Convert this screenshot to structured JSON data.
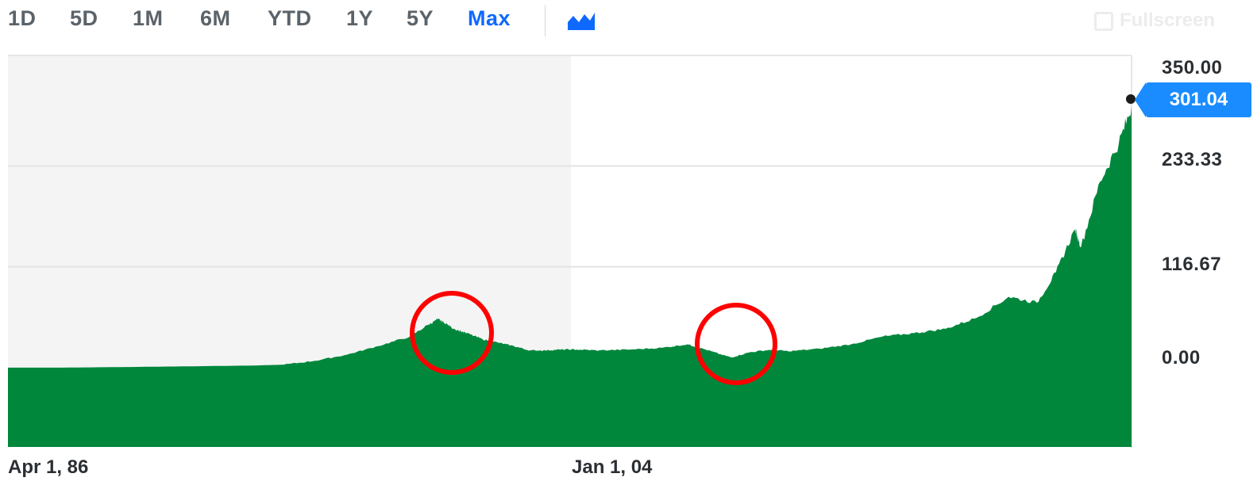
{
  "toolbar": {
    "ranges": [
      "1D",
      "5D",
      "1M",
      "6M",
      "YTD",
      "1Y",
      "5Y",
      "Max"
    ],
    "active_range": "Max",
    "chart_type_icon": "mountain-chart-icon",
    "fullscreen_label": "Fullscreen",
    "accent_color": "#0f69ff"
  },
  "chart_data": {
    "type": "area",
    "title": "",
    "xlabel": "",
    "ylabel": "",
    "x_tick_labels": [
      "Apr 1, 86",
      "Jan 1, 04"
    ],
    "y_tick_labels": [
      "350.00",
      "233.33",
      "116.67",
      "0.00"
    ],
    "ylim": [
      0,
      350
    ],
    "grid": true,
    "last_price": "301.04",
    "area_color": "#00873c",
    "volume_color": "#7ec89a",
    "price_tag_color": "#1a8cff",
    "annotations": [
      {
        "shape": "circle",
        "color": "#ff0000",
        "near": "2000 peak"
      },
      {
        "shape": "circle",
        "color": "#ff0000",
        "near": "2009 trough"
      }
    ],
    "series": [
      {
        "values": [
          [
            1986.25,
            0.1
          ],
          [
            1988,
            0.1
          ],
          [
            1990,
            0.8
          ],
          [
            1992,
            1.6
          ],
          [
            1994,
            2.5
          ],
          [
            1995,
            3.5
          ],
          [
            1996,
            8
          ],
          [
            1997,
            15
          ],
          [
            1998,
            25
          ],
          [
            1999,
            36
          ],
          [
            1999.6,
            50
          ],
          [
            1999.9,
            56
          ],
          [
            2000.1,
            52
          ],
          [
            2000.4,
            45
          ],
          [
            2000.8,
            40
          ],
          [
            2001.3,
            33
          ],
          [
            2001.8,
            29
          ],
          [
            2002.3,
            25
          ],
          [
            2002.8,
            20
          ],
          [
            2003.3,
            20
          ],
          [
            2003.8,
            21
          ],
          [
            2004.3,
            21
          ],
          [
            2005,
            20
          ],
          [
            2006,
            21
          ],
          [
            2007,
            23
          ],
          [
            2007.8,
            27
          ],
          [
            2008.3,
            22
          ],
          [
            2008.9,
            15
          ],
          [
            2009.2,
            12
          ],
          [
            2009.8,
            18
          ],
          [
            2010.5,
            21
          ],
          [
            2011,
            19
          ],
          [
            2012,
            22
          ],
          [
            2013,
            27
          ],
          [
            2014,
            36
          ],
          [
            2015,
            40
          ],
          [
            2016,
            45
          ],
          [
            2017,
            58
          ],
          [
            2018,
            82
          ],
          [
            2018.9,
            75
          ],
          [
            2019.5,
            110
          ],
          [
            2020.1,
            160
          ],
          [
            2020.3,
            140
          ],
          [
            2020.9,
            215
          ],
          [
            2021.5,
            260
          ],
          [
            2021.9,
            301.04
          ]
        ]
      }
    ]
  }
}
